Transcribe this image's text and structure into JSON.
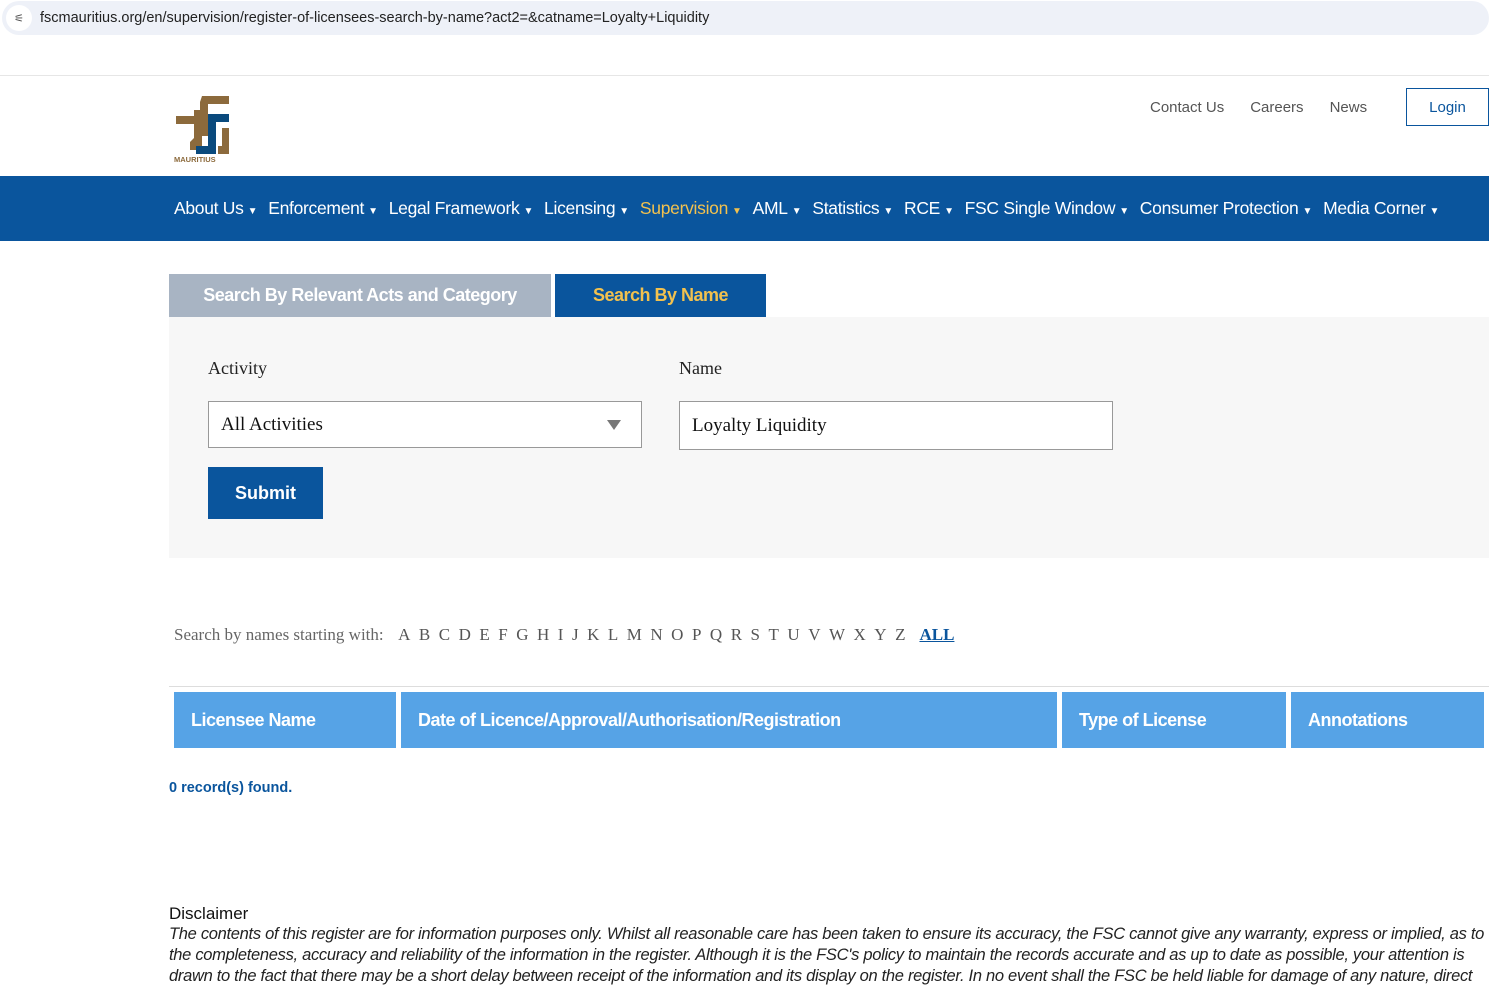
{
  "browser": {
    "url": "fscmauritius.org/en/supervision/register-of-licensees-search-by-name?act2=&catname=Loyalty+Liquidity"
  },
  "header": {
    "logo_text": "MAURITIUS",
    "links": [
      "Contact Us",
      "Careers",
      "News"
    ],
    "login": "Login"
  },
  "nav": [
    {
      "label": "About Us"
    },
    {
      "label": "Enforcement"
    },
    {
      "label": "Legal Framework"
    },
    {
      "label": "Licensing"
    },
    {
      "label": "Supervision",
      "active": true
    },
    {
      "label": "AML"
    },
    {
      "label": "Statistics"
    },
    {
      "label": "RCE"
    },
    {
      "label": "FSC Single Window"
    },
    {
      "label": "Consumer Protection"
    },
    {
      "label": "Media Corner"
    }
  ],
  "tabs": {
    "acts": "Search By Relevant Acts and Category",
    "name": "Search By Name"
  },
  "form": {
    "activity_label": "Activity",
    "activity_value": "All Activities",
    "name_label": "Name",
    "name_value": "Loyalty Liquidity",
    "submit": "Submit"
  },
  "alpha": {
    "label": "Search by names starting with:",
    "letters": [
      "A",
      "B",
      "C",
      "D",
      "E",
      "F",
      "G",
      "H",
      "I",
      "J",
      "K",
      "L",
      "M",
      "N",
      "O",
      "P",
      "Q",
      "R",
      "S",
      "T",
      "U",
      "V",
      "W",
      "X",
      "Y",
      "Z"
    ],
    "all": "ALL"
  },
  "table": {
    "headers": [
      "Licensee Name",
      "Date of Licence/Approval/Authorisation/Registration",
      "Type of License",
      "Annotations"
    ]
  },
  "result": "0 record(s) found.",
  "disclaimer": {
    "title": "Disclaimer",
    "text": "The contents of this register are for information purposes only. Whilst all reasonable care has been taken to ensure its accuracy, the FSC cannot give any warranty, express or implied, as to the completeness, accuracy and reliability of the information in the register. Although it is the FSC's policy to maintain the records accurate and as up to date as possible, your attention is drawn to the fact that there may be a short delay between receipt of the information and its display on the register. In no event shall the FSC be held liable for damage of any nature, direct"
  }
}
